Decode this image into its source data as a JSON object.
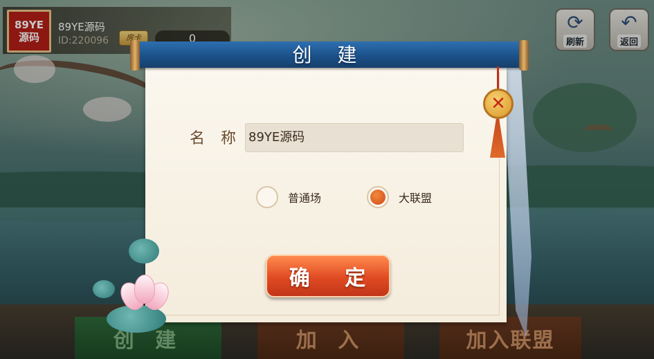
{
  "player": {
    "avatar_line1": "89YE",
    "avatar_line2": "源码",
    "name": "89YE源码",
    "id_text": "ID:220096",
    "card_icon_label": "房卡",
    "card_count": "0"
  },
  "top_buttons": {
    "refresh_label": "刷新",
    "back_label": "返回",
    "refresh_icon": "refresh-icon",
    "back_icon": "back-arrow-icon"
  },
  "bottom_tabs": {
    "create": "创 建",
    "join": "加 入",
    "join_league": "加入联盟"
  },
  "dialog": {
    "title": "创 建",
    "name_label": "名 称",
    "name_value": "89YE源码",
    "radio_options": [
      {
        "label": "普通场",
        "selected": false
      },
      {
        "label": "大联盟",
        "selected": true
      }
    ],
    "confirm_label": "确 定",
    "close_icon": "close-icon"
  },
  "colors": {
    "accent_orange": "#e04a22",
    "title_bar_blue": "#1a4f86",
    "paper": "#fbf7ee"
  }
}
